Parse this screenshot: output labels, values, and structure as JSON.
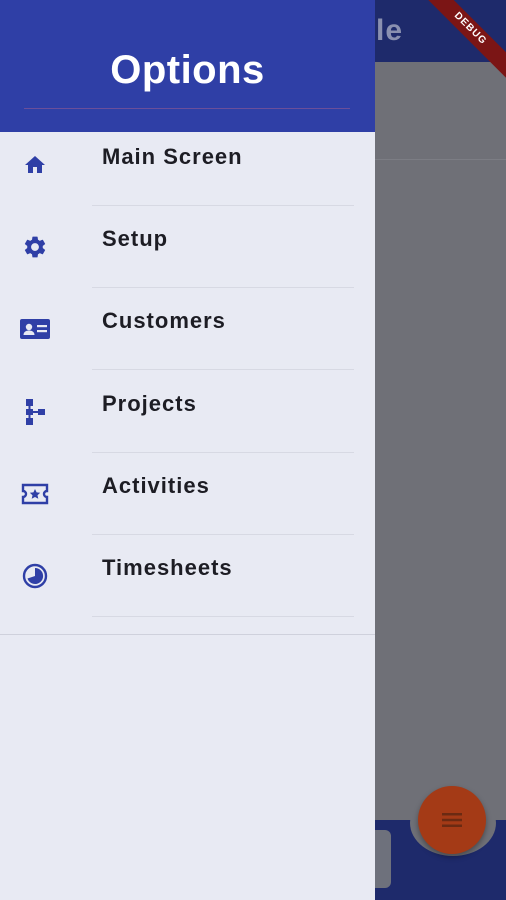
{
  "background_app": {
    "title_fragment": "le",
    "debug_banner": "DEBUG"
  },
  "drawer": {
    "title": "Options",
    "items": [
      {
        "label": "Main Screen",
        "icon": "home-icon"
      },
      {
        "label": "Setup",
        "icon": "gear-icon"
      },
      {
        "label": "Customers",
        "icon": "contact-card-icon"
      },
      {
        "label": "Projects",
        "icon": "hierarchy-icon"
      },
      {
        "label": "Activities",
        "icon": "ticket-star-icon"
      },
      {
        "label": "Timesheets",
        "icon": "clock-icon"
      }
    ]
  },
  "colors": {
    "primary": "#2f3fa6",
    "drawer_bg": "#e8eaf3",
    "fab": "#a43a16",
    "scrim": "#6f7077"
  }
}
